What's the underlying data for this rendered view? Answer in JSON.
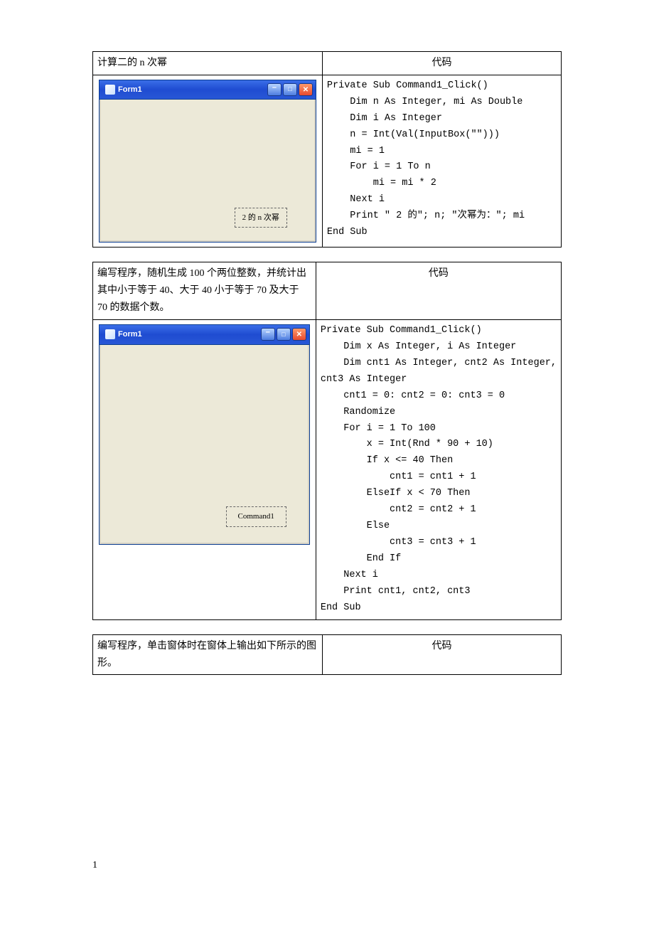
{
  "table1": {
    "left_header": "计算二的 n 次幂",
    "right_header": "代码",
    "form": {
      "title": "Form1",
      "button": "2 的 n 次幂"
    },
    "code": "Private Sub Command1_Click()\n    Dim n As Integer, mi As Double\n    Dim i As Integer\n    n = Int(Val(InputBox(\"\")))\n    mi = 1\n    For i = 1 To n\n        mi = mi * 2\n    Next i\n    Print \" 2 的\"; n; \"次幂为：\"; mi\nEnd Sub"
  },
  "table2": {
    "left_header": "编写程序，随机生成 100 个两位整数，并统计出其中小于等于 40、大于 40 小于等于 70 及大于 70 的数据个数。",
    "right_header": "代码",
    "form": {
      "title": "Form1",
      "button": "Command1"
    },
    "code": "Private Sub Command1_Click()\n    Dim x As Integer, i As Integer\n    Dim cnt1 As Integer, cnt2 As Integer,\ncnt3 As Integer\n    cnt1 = 0: cnt2 = 0: cnt3 = 0\n    Randomize\n    For i = 1 To 100\n        x = Int(Rnd * 90 + 10)\n        If x <= 40 Then\n            cnt1 = cnt1 + 1\n        ElseIf x < 70 Then\n            cnt2 = cnt2 + 1\n        Else\n            cnt3 = cnt3 + 1\n        End If\n    Next i\n    Print cnt1, cnt2, cnt3\nEnd Sub"
  },
  "table3": {
    "left_header": "编写程序，单击窗体时在窗体上输出如下所示的图形。",
    "right_header": "代码"
  },
  "page_number": "1"
}
